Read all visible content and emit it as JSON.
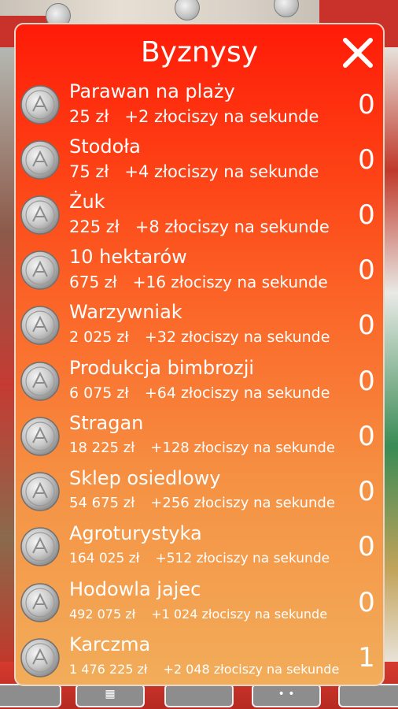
{
  "dialog": {
    "title": "Byznysy",
    "close_icon": "close-x-icon"
  },
  "businesses": [
    {
      "name": "Parawan na plaży",
      "price": "25 zł",
      "income": "+2 złociszy na sekunde",
      "owned": "0"
    },
    {
      "name": "Stodoła",
      "price": "75 zł",
      "income": "+4 złociszy na sekunde",
      "owned": "0"
    },
    {
      "name": "Żuk",
      "price": "225 zł",
      "income": "+8 złociszy na sekunde",
      "owned": "0"
    },
    {
      "name": "10 hektarów",
      "price": "675 zł",
      "income": "+16 złociszy na sekunde",
      "owned": "0"
    },
    {
      "name": "Warzywniak",
      "price": "2 025 zł",
      "income": "+32 złociszy na sekunde",
      "owned": "0"
    },
    {
      "name": "Produkcja bimbrozji",
      "price": "6 075 zł",
      "income": "+64 złociszy na sekunde",
      "owned": "0"
    },
    {
      "name": "Stragan",
      "price": "18 225 zł",
      "income": "+128 złociszy na sekunde",
      "owned": "0"
    },
    {
      "name": "Sklep osiedlowy",
      "price": "54 675 zł",
      "income": "+256 złociszy na sekunde",
      "owned": "0"
    },
    {
      "name": "Agroturystyka",
      "price": "164 025 zł",
      "income": "+512 złociszy na sekunde",
      "owned": "0"
    },
    {
      "name": "Hodowla jajec",
      "price": "492 075 zł",
      "income": "+1 024 złociszy na sekunde",
      "owned": "0"
    },
    {
      "name": "Karczma",
      "price": "1 476 225 zł",
      "income": "+2 048 złociszy na sekunde",
      "owned": "1"
    }
  ],
  "icons": {
    "business": "coin-icon",
    "bottom_bar": [
      "menu-button",
      "shop-icon",
      "menu-button",
      "dots-icon",
      "menu-button"
    ]
  },
  "colors": {
    "panel_top": "#ff1b08",
    "panel_bottom": "#f2ad5a",
    "text": "#ffffff"
  }
}
